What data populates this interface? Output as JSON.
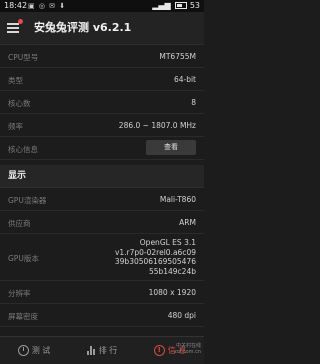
{
  "status_bar": {
    "time": "18:42",
    "icons": "▣ ◎ ✉ ⬇",
    "battery": "53"
  },
  "app_bar": {
    "title": "安兔兔评测 v6.2.1",
    "menu_icon": "hamburger-menu-icon",
    "badge_color": "#e84a4a"
  },
  "cpu": {
    "model_label": "CPU型号",
    "model_value": "MT6755M",
    "type_label": "类型",
    "type_value": "64-bit",
    "cores_label": "核心数",
    "cores_value": "8",
    "freq_label": "频率",
    "freq_value": "286.0 ~ 1807.0 MHz",
    "info_label": "核心信息",
    "info_button": "查看"
  },
  "display": {
    "section_label": "显示",
    "renderer_label": "GPU渲染器",
    "renderer_value": "Mali-T860",
    "vendor_label": "供应商",
    "vendor_value": "ARM",
    "version_label": "GPU版本",
    "version_lines": [
      "OpenGL ES 3.1",
      "v1.r7p0-02rel0.a6c09",
      "39b30506169505476",
      "55b149c24b"
    ],
    "resolution_label": "分辨率",
    "resolution_value": "1080 x 1920",
    "density_label": "屏幕密度",
    "density_value": "480 dpi"
  },
  "bottom_nav": {
    "items": [
      {
        "label": "测 试",
        "icon": "test-icon"
      },
      {
        "label": "排 行",
        "icon": "rank-icon"
      },
      {
        "label": "信 息",
        "icon": "info-icon"
      }
    ],
    "active_index": 2,
    "active_color": "#d84a3f"
  },
  "watermark": {
    "line1": "中关村在线",
    "line2": "zol.com.cn"
  }
}
